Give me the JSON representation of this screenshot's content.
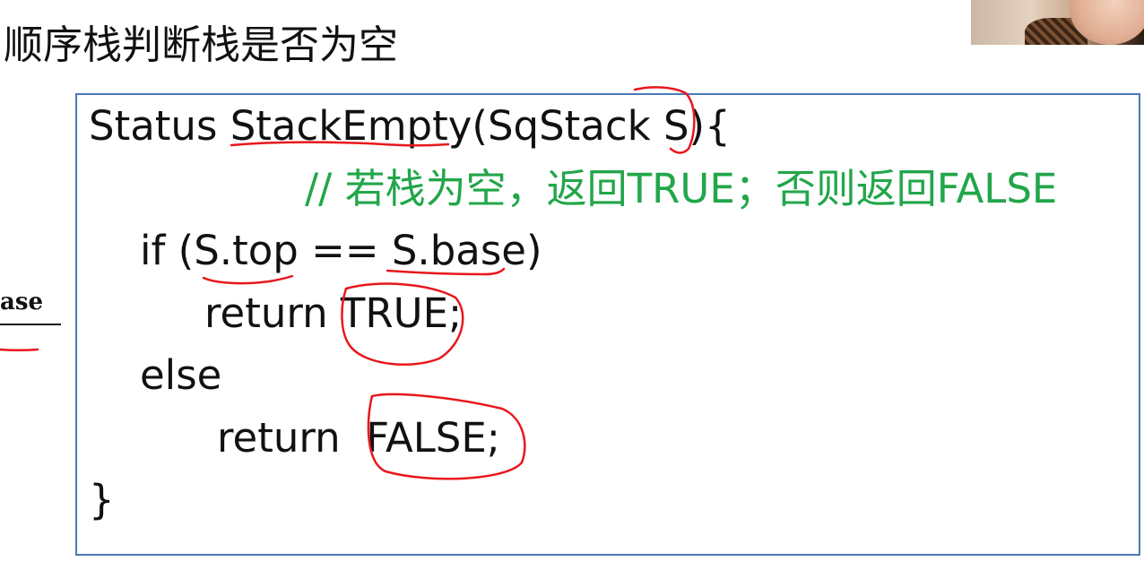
{
  "slide": {
    "title": "顺序栈判断栈是否为空",
    "left_fragment": "ase"
  },
  "code": {
    "line1": "Status StackEmpty(SqStack S){",
    "comment": "// 若栈为空，返回TRUE；否则返回FALSE",
    "line3": "if (S.top == S.base)",
    "line4": "return TRUE;",
    "line5": "else",
    "line6": "return  FALSE;",
    "line7": "}"
  },
  "colors": {
    "border": "#4a7ab8",
    "comment": "#22a64a",
    "annotation": "#e8171d",
    "text": "#111111"
  },
  "icons": {
    "webcam": "presenter-webcam-thumbnail"
  }
}
